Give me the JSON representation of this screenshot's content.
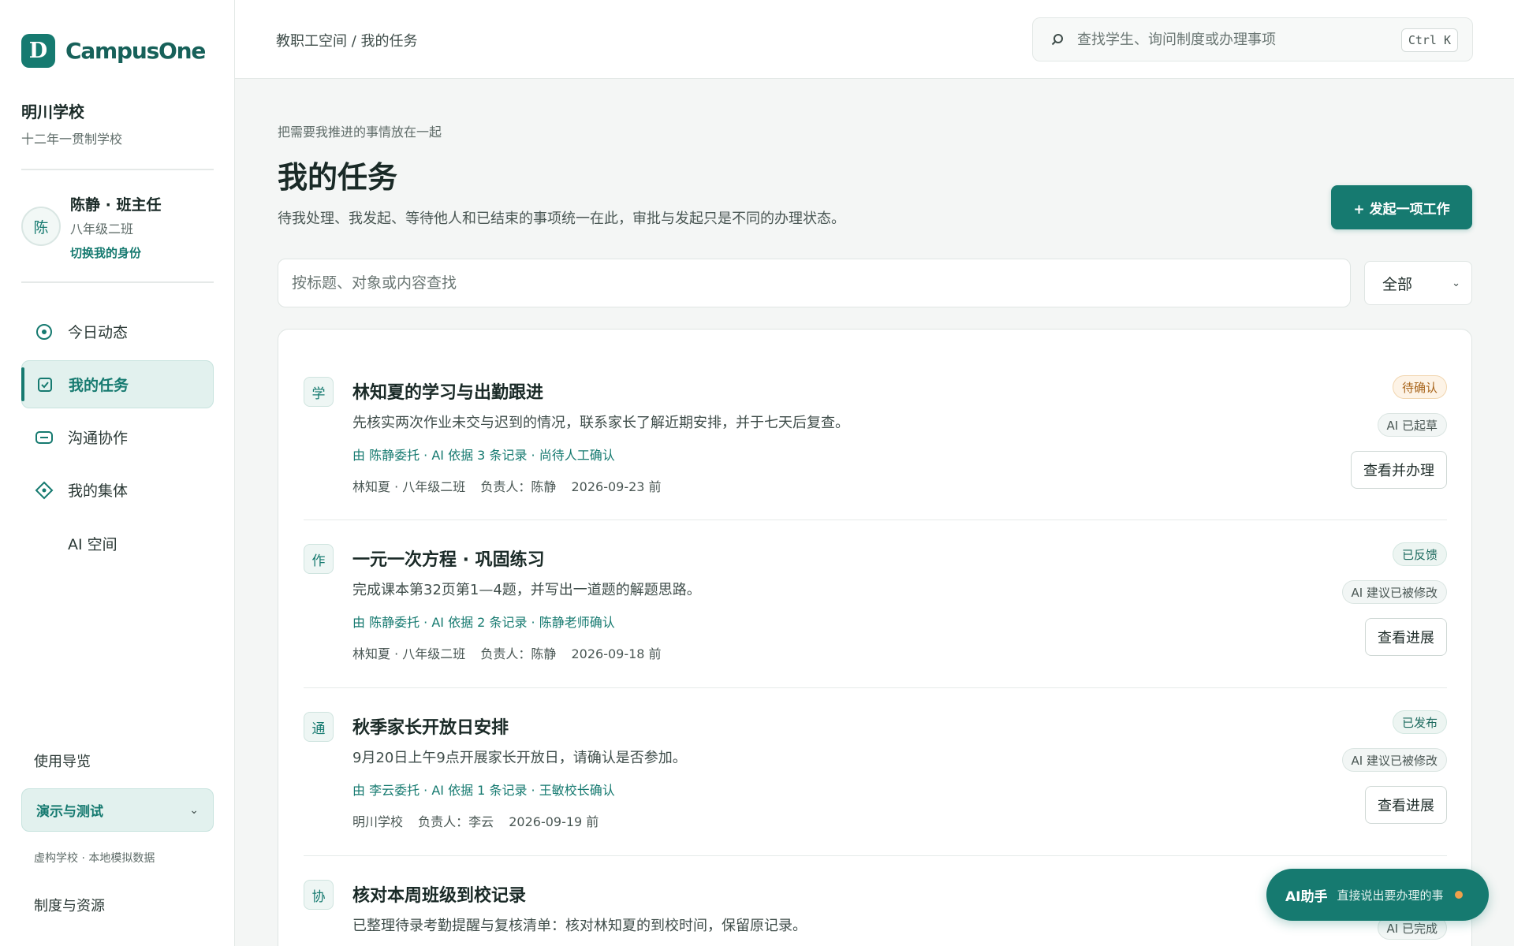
{
  "app": {
    "logo_letter": "D",
    "name": "CampusOne",
    "brand_color": "#167a70"
  },
  "school": {
    "name": "明川学校",
    "subtitle": "十二年一贯制学校"
  },
  "user": {
    "avatar": "陈",
    "name": "陈静 · 班主任",
    "class": "八年级二班",
    "switch_label": "切换我的身份"
  },
  "nav": {
    "items": [
      {
        "label": "今日动态",
        "icon": "target-icon"
      },
      {
        "label": "我的任务",
        "icon": "checkbox-icon",
        "active": true
      },
      {
        "label": "沟通协作",
        "icon": "message-icon"
      },
      {
        "label": "我的集体",
        "icon": "diamond-icon"
      },
      {
        "label": "AI 空间"
      }
    ],
    "guide_label": "使用导览",
    "demo_label": "演示与测试",
    "demo_note": "虚构学校 · 本地模拟数据",
    "resources_label": "制度与资源"
  },
  "header": {
    "breadcrumb_root": "教职工空间",
    "breadcrumb_sep": "/",
    "breadcrumb_current": "我的任务",
    "search_placeholder": "查找学生、询问制度或办理事项",
    "search_shortcut": "Ctrl K"
  },
  "page": {
    "eyebrow": "把需要我推进的事情放在一起",
    "title": "我的任务",
    "description": "待我处理、我发起、等待他人和已结束的事项统一在此，审批与发起只是不同的办理状态。",
    "primary_button": "+ 发起一项工作",
    "filter_placeholder": "按标题、对象或内容查找",
    "filter_value": "全部"
  },
  "tasks": [
    {
      "badge": "学",
      "title": "林知夏的学习与出勤跟进",
      "description": "先核实两次作业未交与迟到的情况，联系家长了解近期安排，并于七天后复查。",
      "source": "由 陈静委托 · AI 依据 3 条记录 · 尚待人工确认",
      "meta_subject": "林知夏 · 八年级二班",
      "meta_owner": "负责人：陈静",
      "meta_due": "2026-09-23 前",
      "status": "待确认",
      "ai_tag": "AI 已起草",
      "action": "查看并办理"
    },
    {
      "badge": "作",
      "title": "一元一次方程 · 巩固练习",
      "description": "完成课本第32页第1—4题，并写出一道题的解题思路。",
      "source": "由 陈静委托 · AI 依据 2 条记录 · 陈静老师确认",
      "meta_subject": "林知夏 · 八年级二班",
      "meta_owner": "负责人：陈静",
      "meta_due": "2026-09-18 前",
      "status": "已反馈",
      "ai_tag": "AI 建议已被修改",
      "action": "查看进展"
    },
    {
      "badge": "通",
      "title": "秋季家长开放日安排",
      "description": "9月20日上午9点开展家长开放日，请确认是否参加。",
      "source": "由 李云委托 · AI 依据 1 条记录 · 王敏校长确认",
      "meta_subject": "明川学校",
      "meta_owner": "负责人：李云",
      "meta_due": "2026-09-19 前",
      "status": "已发布",
      "ai_tag": "AI 建议已被修改",
      "action": "查看进展"
    },
    {
      "badge": "协",
      "title": "核对本周班级到校记录",
      "description": "已整理待录考勤提醒与复核清单：核对林知夏的到校时间，保留原记录。",
      "ai_tag": "AI 已完成"
    }
  ],
  "ai_fab": {
    "label": "AI助手",
    "hint": "直接说出要办理的事"
  }
}
